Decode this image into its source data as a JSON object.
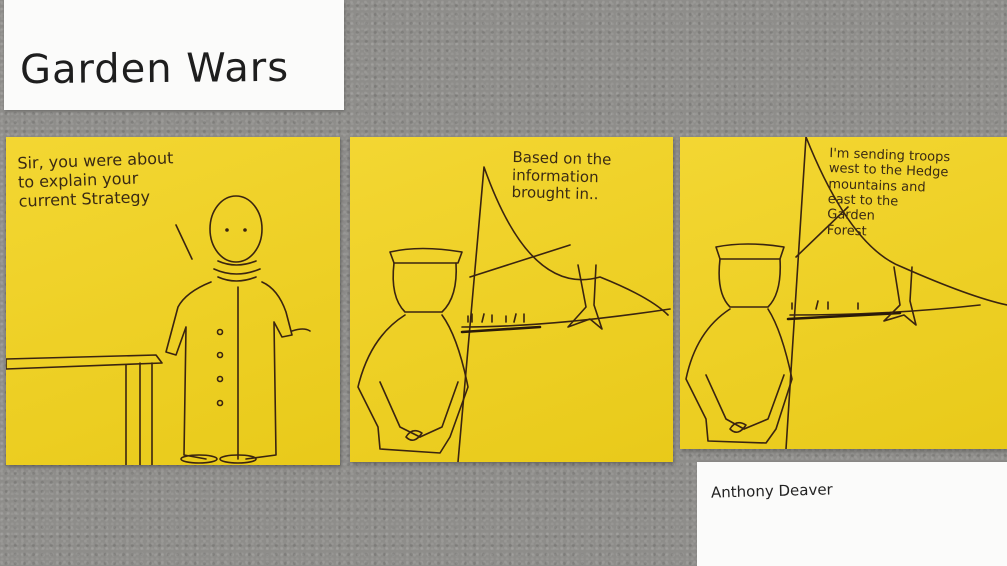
{
  "title": "Garden Wars",
  "author": "Anthony Deaver",
  "panels": [
    {
      "caption": "Sir, you were about\nto explain your\ncurrent Strategy"
    },
    {
      "caption": "Based on the\ninformation\nbrought in.."
    },
    {
      "caption": "I'm sending troops\nwest to the Hedge\nmountains and\neast to the\nGarden\nForest"
    }
  ],
  "colors": {
    "sticky_note": "#f2d21b",
    "board": "#8e8d8a",
    "card": "#fbfbfa",
    "ink": "#3a2410"
  }
}
